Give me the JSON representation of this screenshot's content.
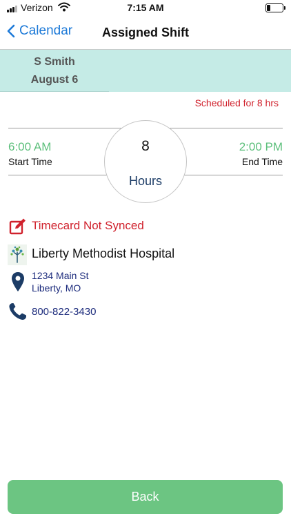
{
  "status_bar": {
    "carrier": "Verizon",
    "time": "7:15 AM",
    "battery_level": 0.25
  },
  "nav": {
    "back_label": "Calendar",
    "title": "Assigned Shift"
  },
  "employee": {
    "name": "S Smith",
    "date": "August 6"
  },
  "shift": {
    "scheduled_text": "Scheduled for 8 hrs",
    "start_time": "6:00 AM",
    "start_label": "Start Time",
    "end_time": "2:00 PM",
    "end_label": "End Time",
    "hours_value": "8",
    "hours_label": "Hours"
  },
  "timecard": {
    "status": "Timecard Not Synced"
  },
  "location": {
    "name": "Liberty Methodist Hospital",
    "address_line1": "1234 Main St",
    "address_line2": "Liberty, MO",
    "phone": "800-822-3430"
  },
  "footer": {
    "back_button_label": "Back"
  },
  "colors": {
    "accent_blue": "#1d7ad8",
    "header_bg": "#c5ebe6",
    "alert_red": "#d0212c",
    "time_green": "#5cbf7b",
    "button_green": "#6cc582",
    "link_navy": "#1c2b7c"
  },
  "icons": {
    "status": [
      "signal-icon",
      "wifi-icon",
      "battery-icon"
    ],
    "nav": "chevron-left-icon",
    "rows": [
      "edit-note-icon",
      "hospital-logo-icon",
      "location-pin-icon",
      "phone-icon"
    ]
  }
}
